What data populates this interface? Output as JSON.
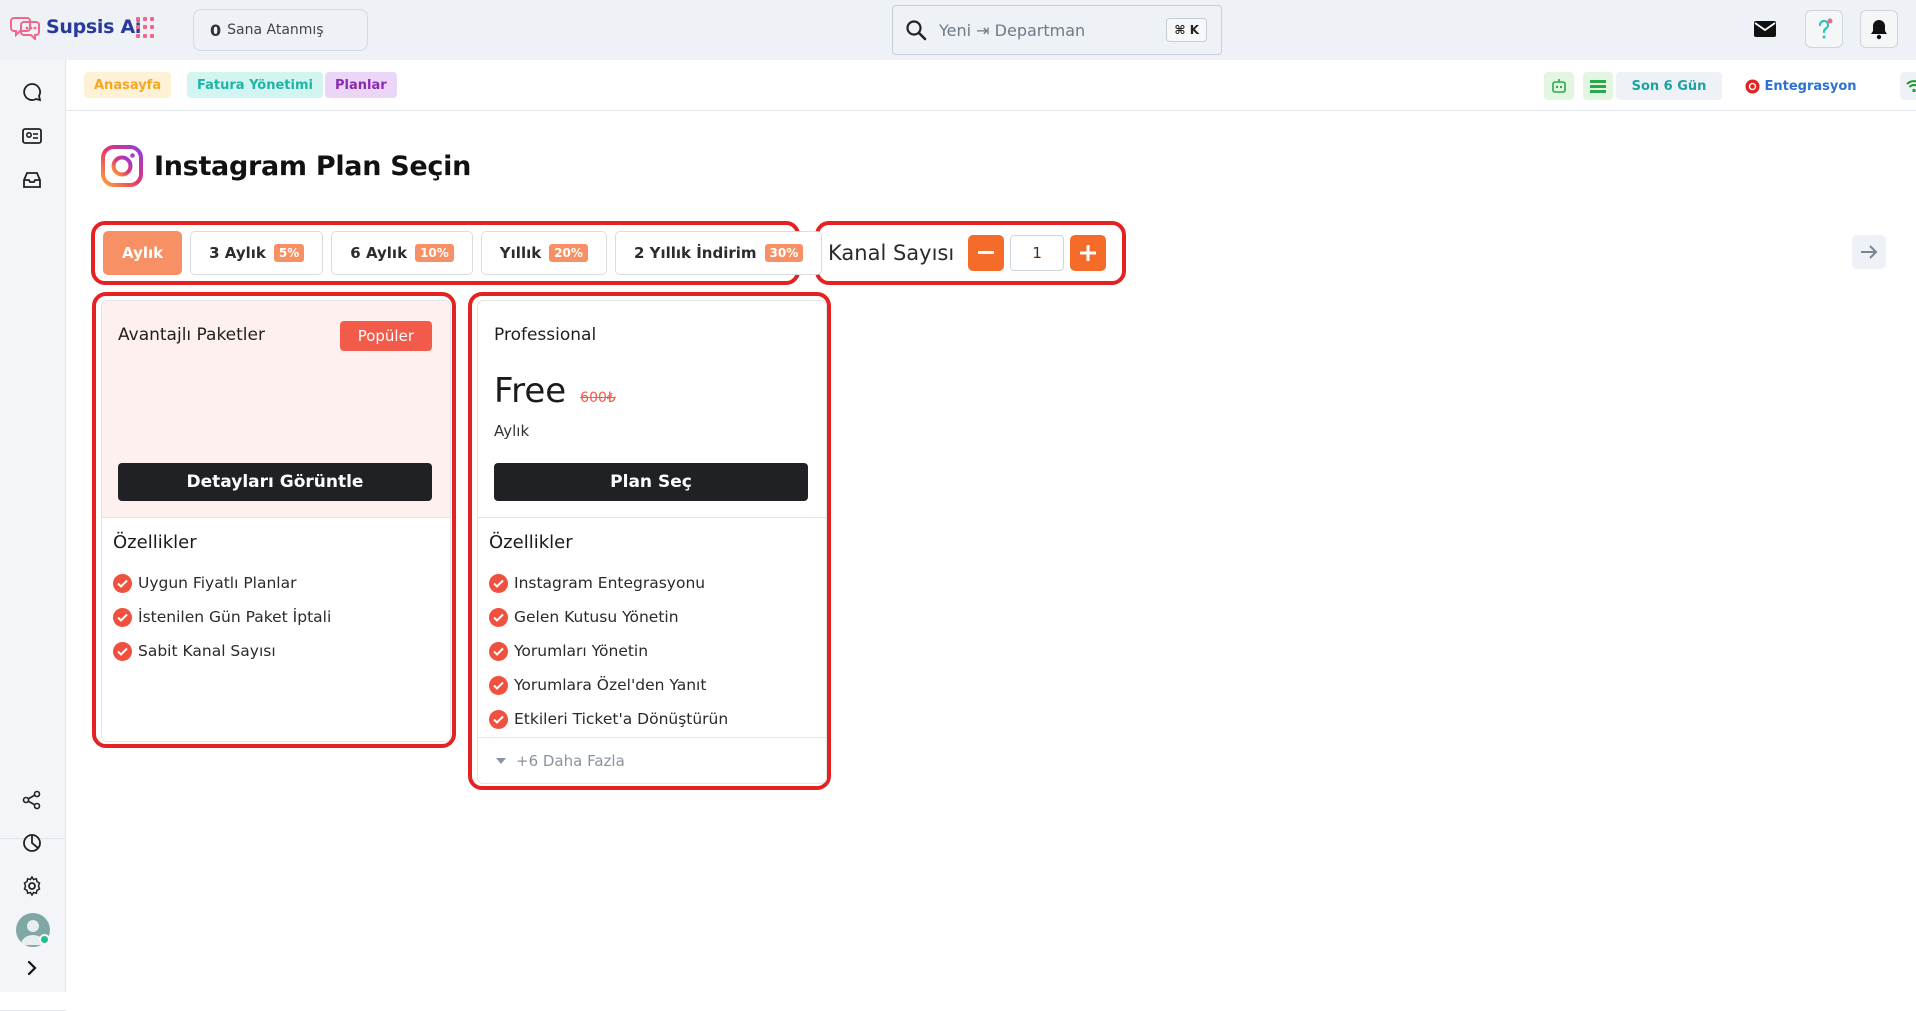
{
  "app": {
    "name": "Supsis Ai"
  },
  "topbar": {
    "assigned_count": "0",
    "assigned_label": "Sana Atanmış",
    "search_placeholder": "Yeni ⇥ Departman",
    "search_shortcut": "⌘ K"
  },
  "breadcrumb": [
    "Anasayfa",
    "Fatura Yönetimi",
    "Planlar"
  ],
  "status": {
    "last_days": "Son 6 Gün",
    "integration": "Entegrasyon"
  },
  "page": {
    "title": "Instagram Plan Seçin"
  },
  "periods": [
    {
      "label": "Aylık",
      "discount": "",
      "active": true
    },
    {
      "label": "3 Aylık",
      "discount": "5%"
    },
    {
      "label": "6 Aylık",
      "discount": "10%"
    },
    {
      "label": "Yıllık",
      "discount": "20%"
    },
    {
      "label": "2 Yıllık İndirim",
      "discount": "30%"
    }
  ],
  "channel": {
    "label": "Kanal Sayısı",
    "value": "1",
    "minus": "−",
    "plus": "+"
  },
  "cards": [
    {
      "name": "Avantajlı Paketler",
      "badge": "Popüler",
      "cta": "Detayları Görüntle",
      "features_title": "Özellikler",
      "features": [
        "Uygun Fiyatlı Planlar",
        "İstenilen Gün Paket İptali",
        "Sabit Kanal Sayısı"
      ]
    },
    {
      "name": "Professional",
      "price": "Free",
      "old_price": "600₺",
      "period": "Aylık",
      "cta": "Plan Seç",
      "features_title": "Özellikler",
      "features": [
        "Instagram Entegrasyonu",
        "Gelen Kutusu Yönetin",
        "Yorumları Yönetin",
        "Yorumlara Özel'den Yanıt",
        "Etkileri Ticket'a Dönüştürün"
      ],
      "more": "+6 Daha Fazla"
    }
  ],
  "colors": {
    "accent": "#f56b2a",
    "highlight": "#e52222",
    "brand": "#2a3a9c"
  }
}
